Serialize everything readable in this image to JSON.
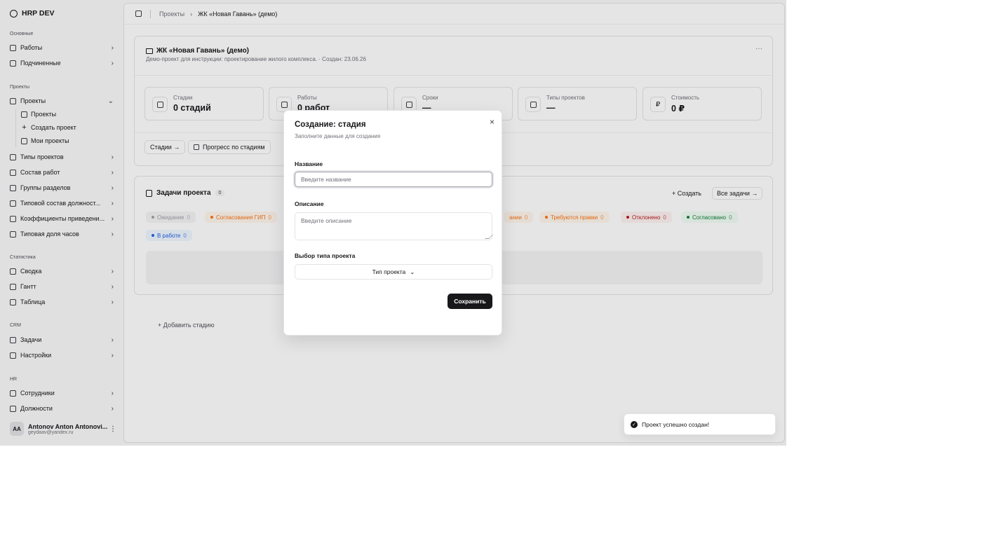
{
  "app": {
    "brand": "HRP DEV"
  },
  "sidebar": {
    "groups": {
      "main": "Основные",
      "projects": "Проекты",
      "stats": "Статистика",
      "crm": "CRM",
      "hr": "HR"
    },
    "items": {
      "works": "Работы",
      "subordinates": "Подчиненные",
      "projects": "Проекты",
      "project_types": "Типы проектов",
      "work_composition": "Состав работ",
      "section_groups": "Группы разделов",
      "typical_positions": "Типовой состав должност...",
      "coefficients": "Коэффициенты приведени...",
      "typical_hours": "Типовая доля часов",
      "summary": "Сводка",
      "gantt": "Гантт",
      "table": "Таблица",
      "tasks": "Задачи",
      "settings": "Настройки",
      "employees": "Сотрудники",
      "positions": "Должности"
    },
    "sub": {
      "projects": "Проекты",
      "create_project": "Создать проект",
      "my_projects": "Мои проекты"
    },
    "user": {
      "initials": "AA",
      "name": "Antonov Anton Antonovi...",
      "email": "geydaav@yandex.ru"
    }
  },
  "breadcrumb": {
    "parent": "Проекты",
    "current": "ЖК «Новая Гавань» (демо)"
  },
  "project": {
    "title": "ЖК «Новая Гавань» (демо)",
    "description": "Демо-проект для инструкции: проектирование жилого комплекса. · Создан: 23.06.26",
    "more": "···",
    "stats": [
      {
        "label": "Стадии",
        "value": "0 стадий",
        "icon": "building-icon"
      },
      {
        "label": "Работы",
        "value": "0 работ",
        "icon": "briefcase-icon"
      },
      {
        "label": "Сроки",
        "value": "—",
        "icon": "calendar-icon"
      },
      {
        "label": "Типы проектов",
        "value": "—",
        "icon": "grid-icon"
      },
      {
        "label": "Стоимость",
        "value": "0 ₽",
        "icon": "ruble-icon",
        "glyph": "₽"
      }
    ],
    "buttons": {
      "stages": "Стадии →",
      "progress": "Прогресс по стадиям"
    }
  },
  "tasks": {
    "title": "Задачи проекта",
    "count": "0",
    "create": "+ Создать",
    "all": "Все задачи →",
    "chips": [
      {
        "label": "Ожидание",
        "count": "0",
        "color": "#a1a1aa",
        "bg": "#f4f4f5"
      },
      {
        "label": "Согласования ГИП",
        "count": "0",
        "color": "#f97316",
        "bg": "#fff7ed"
      },
      {
        "label": "ании",
        "count": "0",
        "color": "#f97316",
        "bg": "#fff7ed"
      },
      {
        "label": "Требуются правки",
        "count": "0",
        "color": "#f97316",
        "bg": "#fff7ed"
      },
      {
        "label": "Отклонено",
        "count": "0",
        "color": "#b91c1c",
        "bg": "#fef2f2"
      },
      {
        "label": "Согласовано",
        "count": "0",
        "color": "#15803d",
        "bg": "#f0fdf4"
      },
      {
        "label": "В работе",
        "count": "0",
        "color": "#2563eb",
        "bg": "#eff6ff"
      }
    ]
  },
  "add_stage": "+ Добавить стадию",
  "modal": {
    "close": "×",
    "title": "Создание: стадия",
    "subtitle": "Заполните данные для создания",
    "name_label": "Название",
    "name_placeholder": "Введите название",
    "desc_label": "Описание",
    "desc_placeholder": "Введите описание",
    "type_label": "Выбор типа проекта",
    "type_select": "Тип проекта",
    "chevron": "⌄",
    "save": "Сохранить"
  },
  "toast": {
    "message": "Проект успешно создан!",
    "check": "✓"
  }
}
